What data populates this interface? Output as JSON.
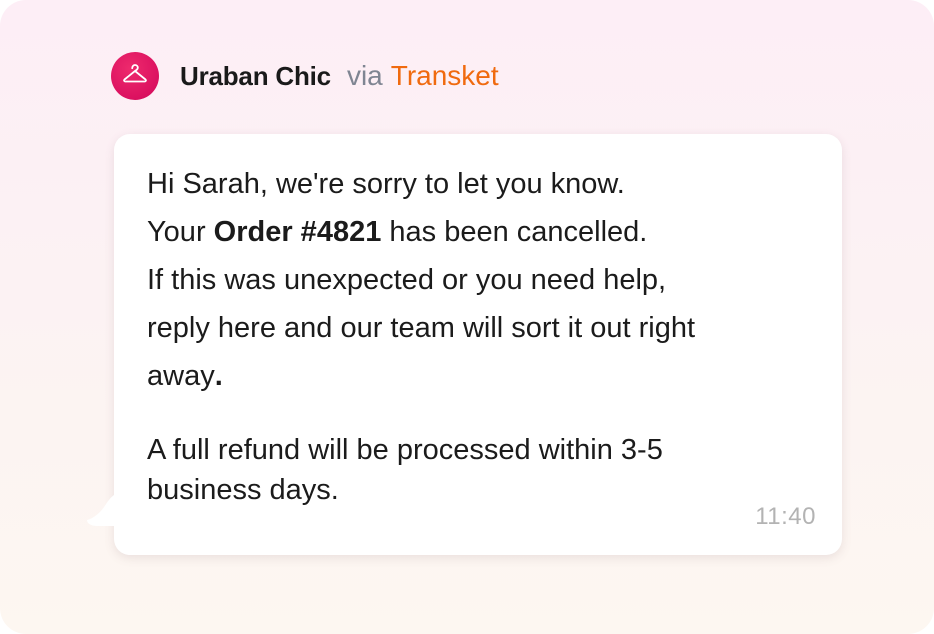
{
  "header": {
    "sender_name": "Uraban Chic",
    "via_label": "via",
    "via_brand": "Transket"
  },
  "avatar": {
    "icon": "hanger-icon",
    "bg_color": "#e0195f"
  },
  "message": {
    "line1": "Hi Sarah, we're sorry to let you know.",
    "line2_pre": "Your ",
    "line2_bold": "Order #4821",
    "line2_post": " has been cancelled.",
    "line3": "If this was unexpected or you need help,",
    "line4": "reply here and our team will sort it out right",
    "line5": "away",
    "line5_period": ".",
    "line6": "A full refund will be processed within 3-5",
    "line7": "business days.",
    "time": "11:40"
  },
  "colors": {
    "brand_orange": "#f06a0f",
    "via_gray": "#7f8592",
    "timestamp_gray": "#b3b3b3"
  }
}
